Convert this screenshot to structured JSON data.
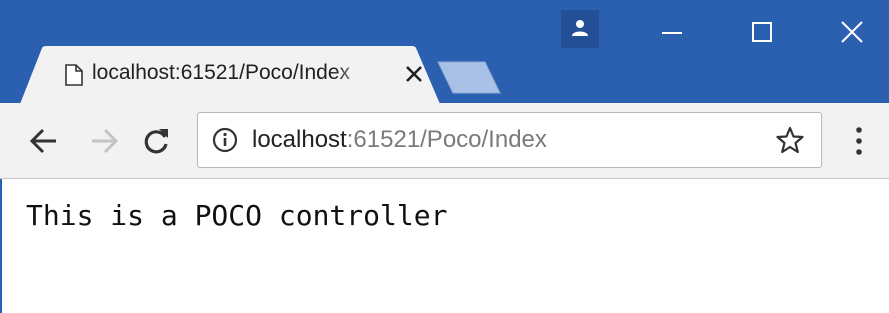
{
  "browser": {
    "colors": {
      "frame": "#2b5fb0",
      "toolbar": "#f2f2f2",
      "tab": "#f2f2f2",
      "inactive_tab": "#a9c1e6"
    }
  },
  "tab": {
    "title": "localhost:61521/Poco/Index",
    "favicon": "page-icon",
    "close_icon": "close-icon"
  },
  "titlebar": {
    "profile_icon": "person-icon",
    "minimize_icon": "minimize-icon",
    "maximize_icon": "maximize-icon",
    "close_icon": "close-icon"
  },
  "toolbar": {
    "back_icon": "back-arrow-icon",
    "forward_icon": "forward-arrow-icon",
    "reload_icon": "reload-icon",
    "menu_icon": "kebab-menu-icon"
  },
  "omnibox": {
    "info_icon": "info-icon",
    "url_host": "localhost",
    "url_rest": ":61521/Poco/Index",
    "star_icon": "star-outline-icon"
  },
  "page": {
    "text": "This is a POCO controller"
  }
}
